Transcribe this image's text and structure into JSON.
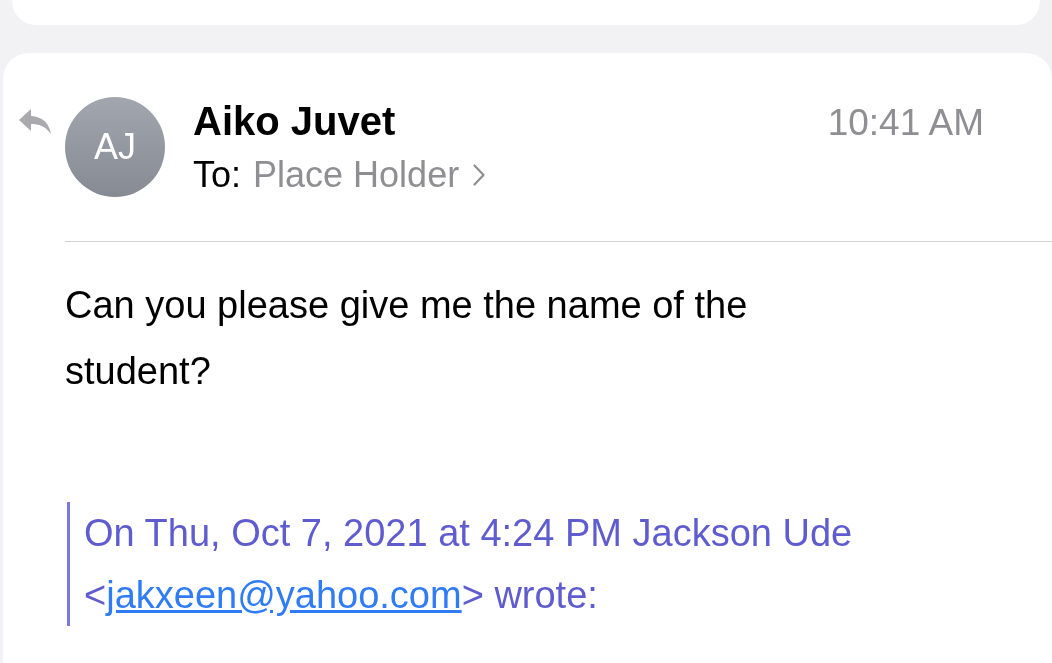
{
  "message": {
    "sender": "Aiko Juvet",
    "initials": "AJ",
    "to_label": "To:",
    "recipient": "Place Holder",
    "time": "10:41 AM",
    "body": "Can you please give me the name of the student?",
    "quote": {
      "attribution_before": "On Thu, Oct 7, 2021 at 4:24 PM Jackson Ude <",
      "email": "jakxeen@yahoo.com",
      "attribution_after": "> wrote:"
    }
  }
}
